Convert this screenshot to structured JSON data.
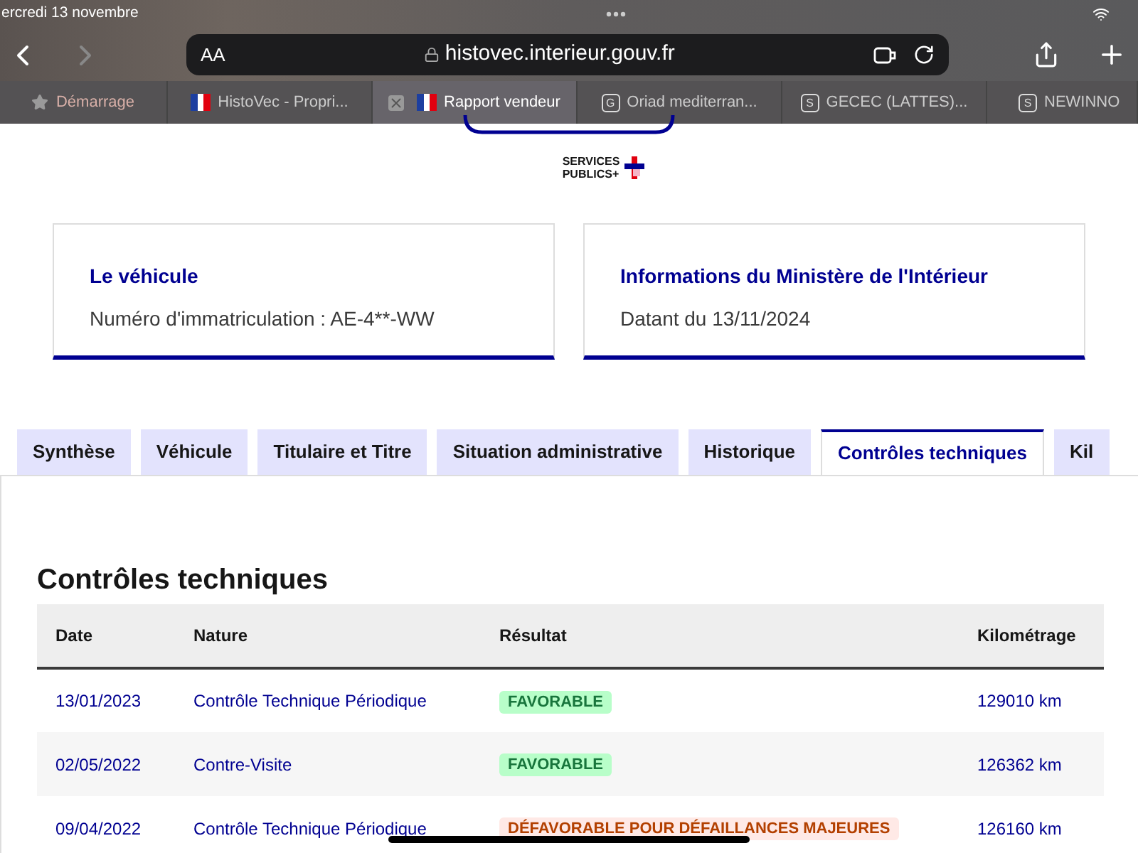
{
  "status_bar": {
    "date": "ercredi 13 novembre"
  },
  "browser": {
    "text_size": "AA",
    "url": "histovec.interieur.gouv.fr",
    "tabs": [
      {
        "label": "Démarrage",
        "kind": "star",
        "selected": false
      },
      {
        "label": "HistoVec - Propri...",
        "kind": "flag",
        "selected": false
      },
      {
        "label": "Rapport vendeur",
        "kind": "flag",
        "selected": true
      },
      {
        "label": "Oriad mediterran...",
        "kind": "letter",
        "letter": "G",
        "selected": false
      },
      {
        "label": "GECEC (LATTES)...",
        "kind": "letter",
        "letter": "S",
        "selected": false
      },
      {
        "label": "NEWINNO",
        "kind": "letter",
        "letter": "S",
        "selected": false
      }
    ]
  },
  "logo": {
    "line1": "SERVICES",
    "line2": "PUBLICS+"
  },
  "cards": [
    {
      "title": "Le véhicule",
      "text": "Numéro d'immatriculation : AE-4**-WW"
    },
    {
      "title": "Informations du Ministère de l'Intérieur",
      "text": "Datant du 13/11/2024"
    }
  ],
  "section_tabs": [
    {
      "label": "Synthèse",
      "selected": false
    },
    {
      "label": "Véhicule",
      "selected": false
    },
    {
      "label": "Titulaire et Titre",
      "selected": false
    },
    {
      "label": "Situation administrative",
      "selected": false
    },
    {
      "label": "Historique",
      "selected": false
    },
    {
      "label": "Contrôles techniques",
      "selected": true
    },
    {
      "label": "Kil",
      "selected": false
    }
  ],
  "section_title": "Contrôles techniques",
  "table": {
    "columns": [
      "Date",
      "Nature",
      "Résultat",
      "Kilométrage"
    ],
    "rows": [
      {
        "date": "13/01/2023",
        "nature": "Contrôle Technique Périodique",
        "result": "FAVORABLE",
        "kind": "ok",
        "km": "129010 km"
      },
      {
        "date": "02/05/2022",
        "nature": "Contre-Visite",
        "result": "FAVORABLE",
        "kind": "ok",
        "km": "126362 km"
      },
      {
        "date": "09/04/2022",
        "nature": "Contrôle Technique Périodique",
        "result": "DÉFAVORABLE POUR DÉFAILLANCES MAJEURES",
        "kind": "fail",
        "km": "126160 km"
      }
    ]
  }
}
